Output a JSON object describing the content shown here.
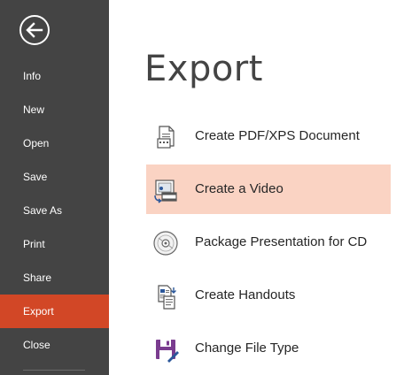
{
  "sidebar": {
    "back_icon": "back-arrow-icon",
    "items": [
      {
        "label": "Info",
        "active": false
      },
      {
        "label": "New",
        "active": false
      },
      {
        "label": "Open",
        "active": false
      },
      {
        "label": "Save",
        "active": false
      },
      {
        "label": "Save As",
        "active": false
      },
      {
        "label": "Print",
        "active": false
      },
      {
        "label": "Share",
        "active": false
      },
      {
        "label": "Export",
        "active": true
      },
      {
        "label": "Close",
        "active": false
      }
    ]
  },
  "main": {
    "title": "Export",
    "options": [
      {
        "label": "Create PDF/XPS Document",
        "icon": "pdf-document-icon",
        "selected": false
      },
      {
        "label": "Create a Video",
        "icon": "video-icon",
        "selected": true
      },
      {
        "label": "Package Presentation for CD",
        "icon": "cd-icon",
        "selected": false
      },
      {
        "label": "Create Handouts",
        "icon": "handouts-icon",
        "selected": false
      },
      {
        "label": "Change File Type",
        "icon": "save-file-type-icon",
        "selected": false
      }
    ]
  },
  "colors": {
    "sidebar_bg": "#444444",
    "active_item": "#d24726",
    "selected_option_bg": "#fad3c3",
    "title_text": "#444444"
  }
}
